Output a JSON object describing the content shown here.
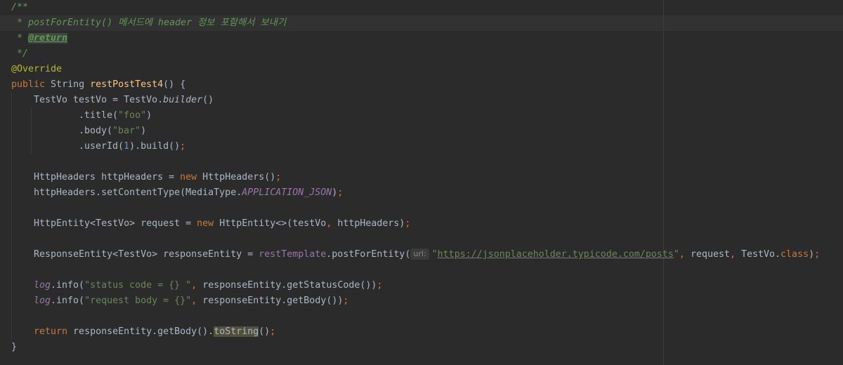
{
  "comment": {
    "open": "/**",
    "line1": " * postForEntity() 메서드에 header 정보 포함해서 보내기",
    "star": " * ",
    "return_tag": "@return",
    "close": " */"
  },
  "annotation": "@Override",
  "signature": {
    "kw_public": "public",
    "ret": " String ",
    "name": "restPostTest4",
    "rest": "() {"
  },
  "builder": {
    "line1_a": "TestVo testVo = TestVo.",
    "line1_b": "builder",
    "line1_c": "()",
    "title_a": ".title(",
    "title_str": "\"foo\"",
    "title_c": ")",
    "body_a": ".body(",
    "body_str": "\"bar\"",
    "body_c": ")",
    "user_a": ".userId(",
    "user_num": "1",
    "user_b": ").build()",
    "semi": ";"
  },
  "headers": {
    "l1_a": "HttpHeaders httpHeaders = ",
    "kw_new": "new",
    "l1_b": " HttpHeaders()",
    "semi": ";",
    "l2_a": "httpHeaders.setContentType(MediaType.",
    "l2_const": "APPLICATION_JSON",
    "l2_b": ")"
  },
  "entity": {
    "a": "HttpEntity<TestVo> request = ",
    "kw_new": "new",
    "b": " HttpEntity<>(testVo",
    "comma": ",",
    "c": " httpHeaders)",
    "semi": ";"
  },
  "response": {
    "a": "ResponseEntity<TestVo> responseEntity = ",
    "field": "restTemplate",
    "b": ".postForEntity(",
    "hint": "url:",
    "q1": "\"",
    "url": "https://jsonplaceholder.typicode.com/posts",
    "q2": "\"",
    "comma": ",",
    "c": " request",
    "d": " TestVo.",
    "kw_class": "class",
    "e": ")",
    "semi": ";"
  },
  "logs": {
    "log": "log",
    "info": ".info(",
    "s1": "\"status code = {} \"",
    "comma": ",",
    "r1": " responseEntity.getStatusCode())",
    "s2": "\"request body = {}\"",
    "r2": " responseEntity.getBody())",
    "semi": ";"
  },
  "ret": {
    "kw": "return",
    "a": " responseEntity.getBody().",
    "hl": "toString",
    "b": "()",
    "semi": ";"
  },
  "close_brace": "}"
}
